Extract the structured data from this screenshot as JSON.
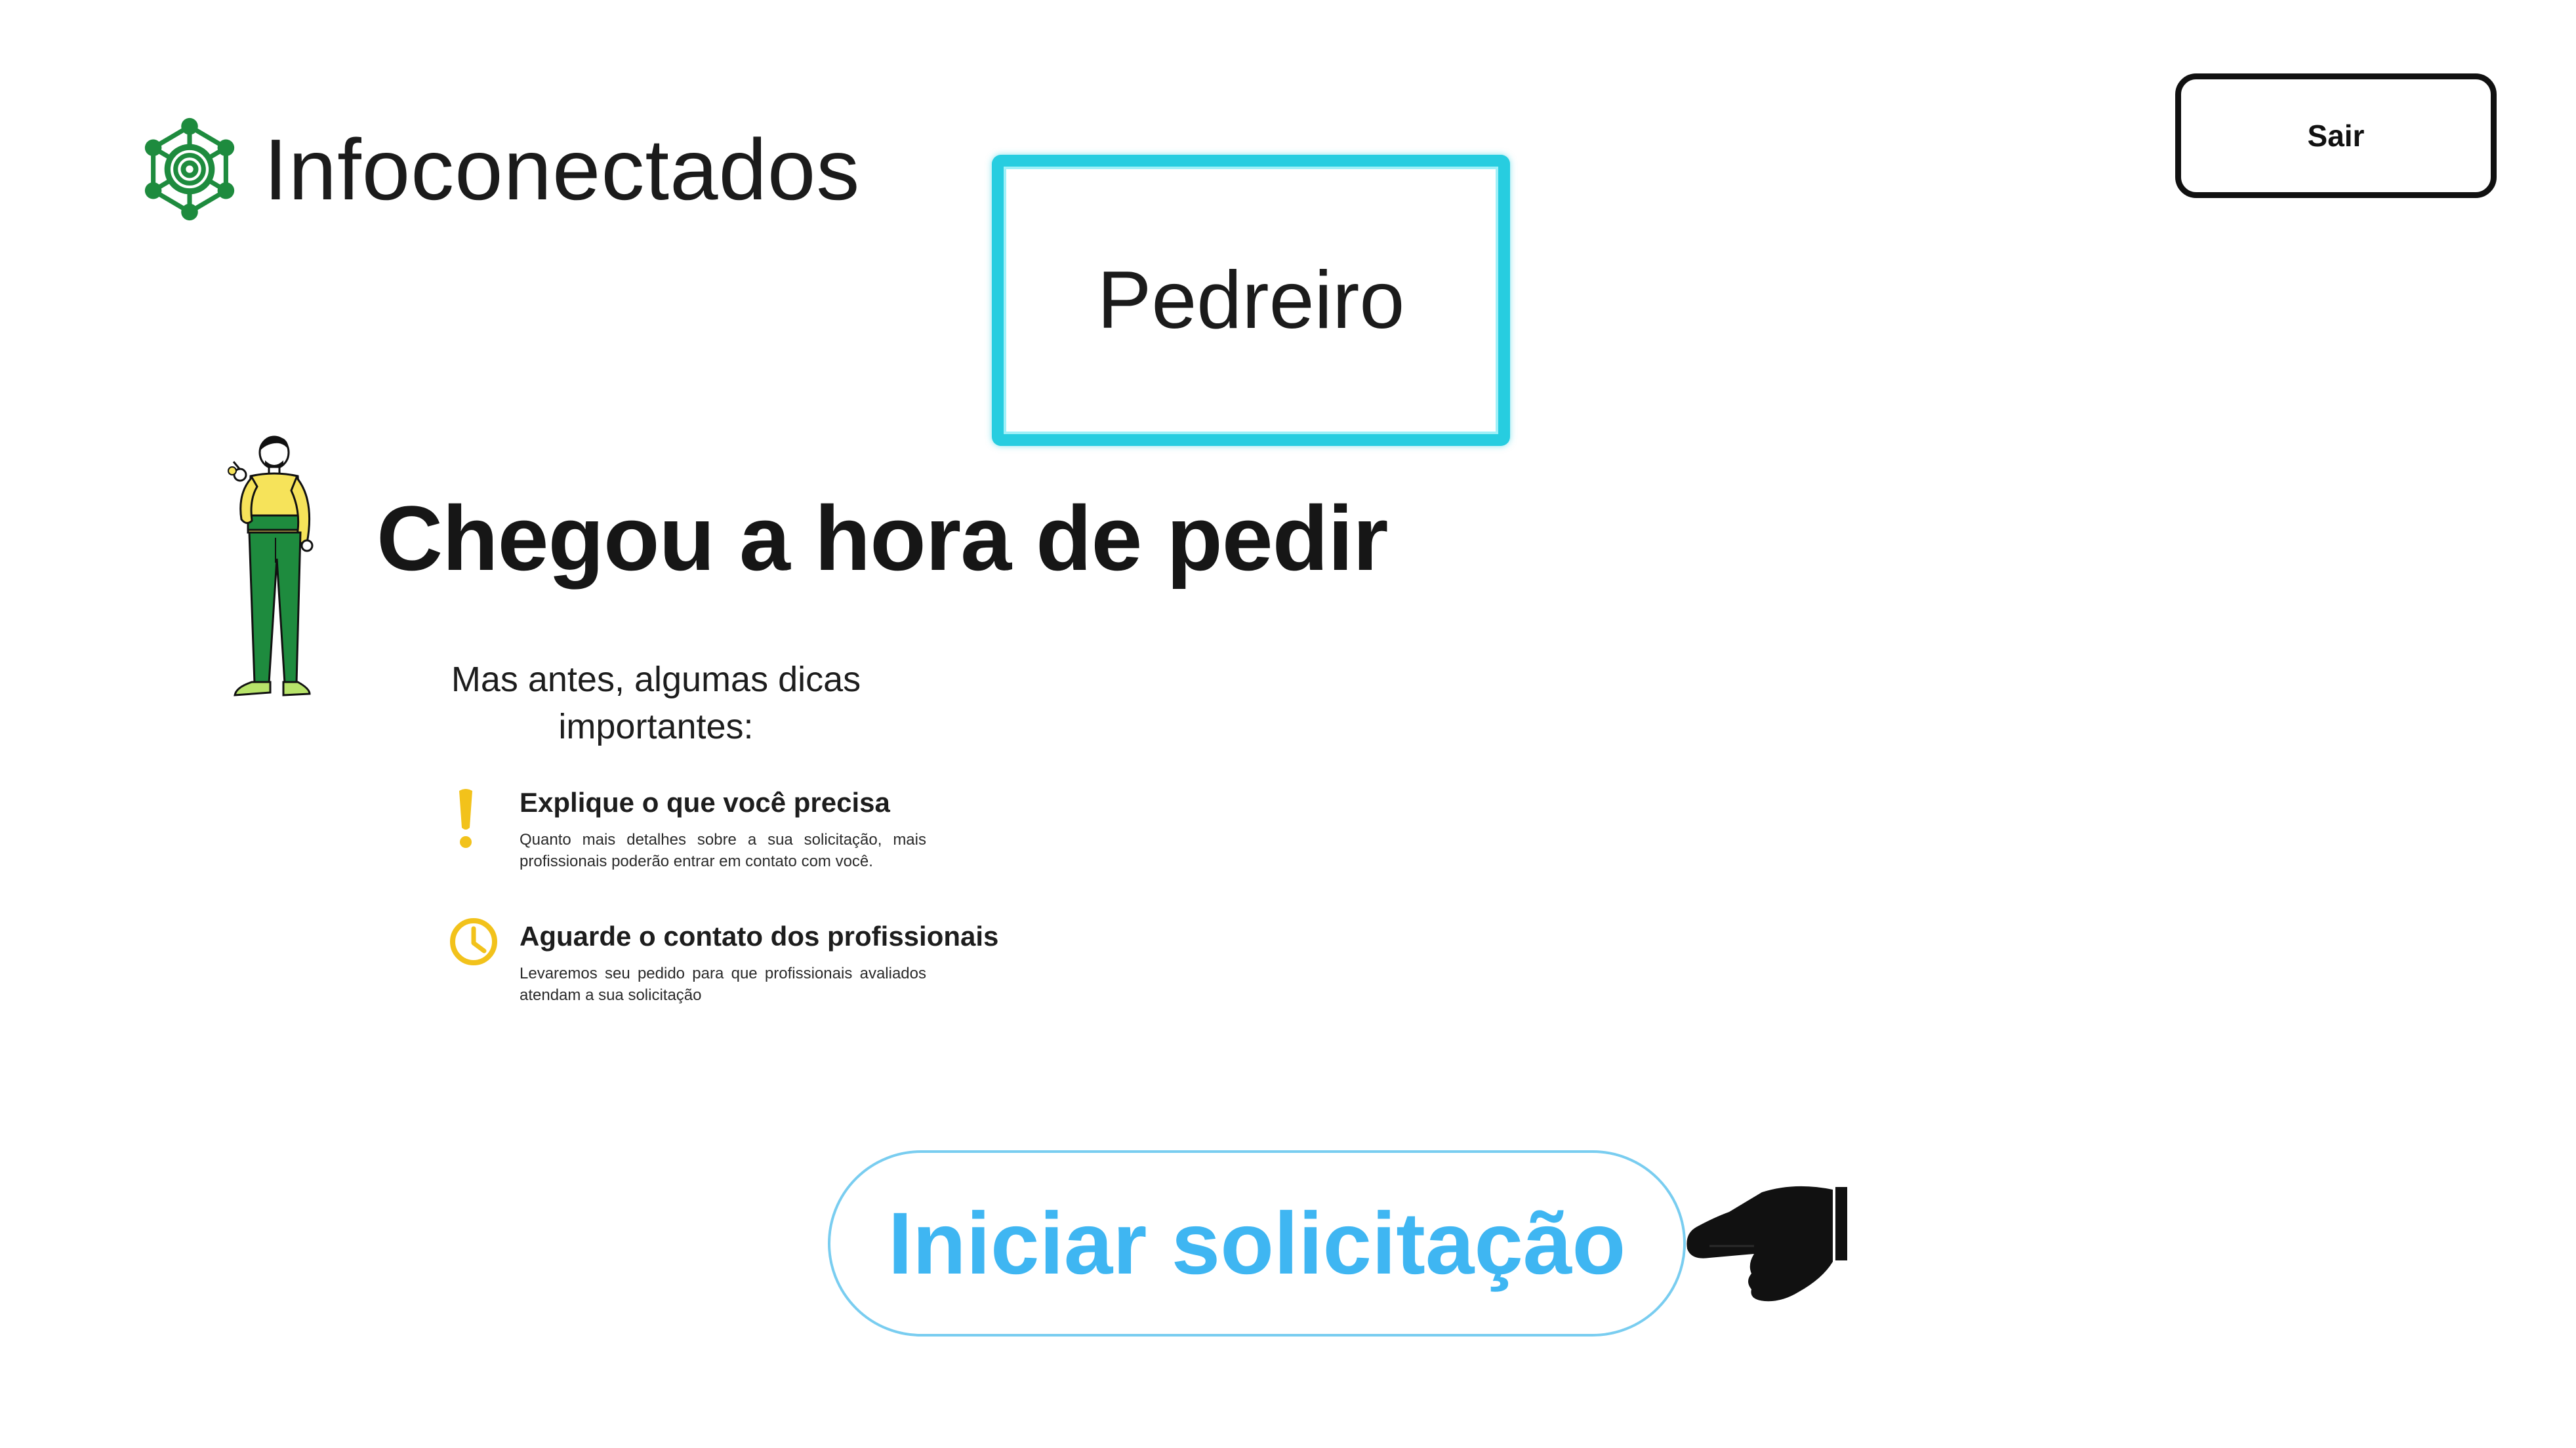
{
  "brand": {
    "name": "Infoconectados",
    "icon": "network-icon",
    "color": "#1e8b3e"
  },
  "header": {
    "exit_label": "Sair"
  },
  "profession": {
    "label": "Pedreiro",
    "border_color": "#27cde0"
  },
  "hero": {
    "title": "Chegou a hora de pedir",
    "intro": "Mas antes, algumas dicas importantes:",
    "character_icon": "person-illustration"
  },
  "tips": [
    {
      "icon": "exclamation-icon",
      "title": "Explique o que você precisa",
      "description": "Quanto mais detalhes sobre a sua solicitação, mais profissionais poderão entrar em contato com você."
    },
    {
      "icon": "clock-icon",
      "title": "Aguarde o contato dos profissionais",
      "description": "Levaremos seu pedido para que profissionais avaliados atendam a sua solicitação"
    }
  ],
  "cta": {
    "label": "Iniciar solicitação",
    "color": "#3fb6f2",
    "icon": "pointing-hand-icon"
  },
  "colors": {
    "accent_yellow": "#f2c21b",
    "green": "#1e8b3e"
  }
}
